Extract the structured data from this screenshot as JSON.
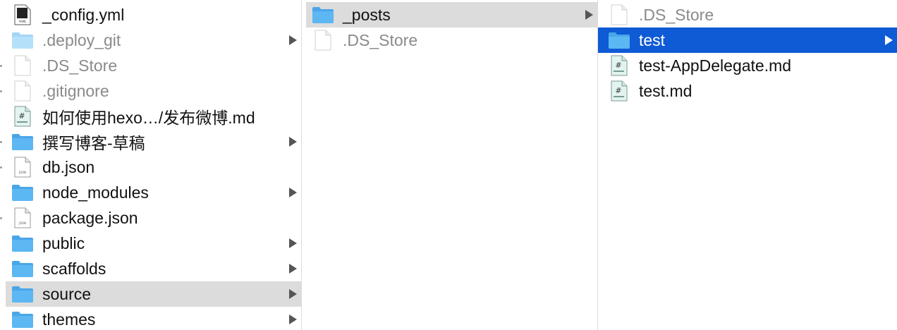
{
  "columns": [
    {
      "items": [
        {
          "label": "_config.yml",
          "icon": "yaml-file-icon",
          "kind": "yaml",
          "arrow": false,
          "state": "",
          "hidden": false
        },
        {
          "label": ".deploy_git",
          "icon": "folder-icon",
          "kind": "folder-light",
          "arrow": true,
          "state": "",
          "hidden": true
        },
        {
          "label": ".DS_Store",
          "icon": "blank-file-icon",
          "kind": "blank",
          "arrow": false,
          "state": "",
          "hidden": true
        },
        {
          "label": ".gitignore",
          "icon": "blank-file-icon",
          "kind": "blank",
          "arrow": false,
          "state": "",
          "hidden": true
        },
        {
          "label": "如何使用hexo…/发布微博.md",
          "icon": "markdown-file-icon",
          "kind": "md",
          "arrow": false,
          "state": "",
          "hidden": false
        },
        {
          "label": "撰写博客-草稿",
          "icon": "folder-icon",
          "kind": "folder",
          "arrow": true,
          "state": "",
          "hidden": false
        },
        {
          "label": "db.json",
          "icon": "json-file-icon",
          "kind": "json",
          "arrow": false,
          "state": "",
          "hidden": false
        },
        {
          "label": "node_modules",
          "icon": "folder-icon",
          "kind": "folder",
          "arrow": true,
          "state": "",
          "hidden": false
        },
        {
          "label": "package.json",
          "icon": "json-file-icon",
          "kind": "json",
          "arrow": false,
          "state": "",
          "hidden": false
        },
        {
          "label": "public",
          "icon": "folder-icon",
          "kind": "folder",
          "arrow": true,
          "state": "",
          "hidden": false
        },
        {
          "label": "scaffolds",
          "icon": "folder-icon",
          "kind": "folder",
          "arrow": true,
          "state": "",
          "hidden": false
        },
        {
          "label": "source",
          "icon": "folder-icon",
          "kind": "folder",
          "arrow": true,
          "state": "sel-gray",
          "hidden": false
        },
        {
          "label": "themes",
          "icon": "folder-icon",
          "kind": "folder",
          "arrow": true,
          "state": "",
          "hidden": false
        }
      ]
    },
    {
      "items": [
        {
          "label": "_posts",
          "icon": "folder-icon",
          "kind": "folder",
          "arrow": true,
          "state": "sel-gray",
          "hidden": false
        },
        {
          "label": ".DS_Store",
          "icon": "blank-file-icon",
          "kind": "blank",
          "arrow": false,
          "state": "",
          "hidden": true
        }
      ]
    },
    {
      "items": [
        {
          "label": ".DS_Store",
          "icon": "blank-file-icon",
          "kind": "blank",
          "arrow": false,
          "state": "",
          "hidden": true
        },
        {
          "label": "test",
          "icon": "folder-icon",
          "kind": "folder",
          "arrow": true,
          "state": "sel-blue",
          "hidden": false
        },
        {
          "label": "test-AppDelegate.md",
          "icon": "markdown-file-icon",
          "kind": "md",
          "arrow": false,
          "state": "",
          "hidden": false
        },
        {
          "label": "test.md",
          "icon": "markdown-file-icon",
          "kind": "md",
          "arrow": false,
          "state": "",
          "hidden": false
        }
      ]
    }
  ],
  "colors": {
    "selection_blue": "#0f5ad5",
    "selection_gray": "#dcdcdc",
    "folder_blue": "#5cb7f2",
    "folder_light": "#b6e0fa"
  }
}
